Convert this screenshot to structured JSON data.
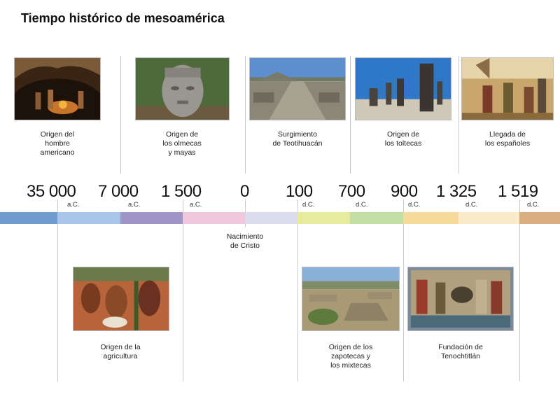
{
  "title": "Tiempo histórico de mesoamérica",
  "years": [
    {
      "value": "35 000",
      "era": "a.C."
    },
    {
      "value": "7 000",
      "era": "a.C."
    },
    {
      "value": "1 500",
      "era": "a.C."
    },
    {
      "value": "0",
      "era": ""
    },
    {
      "value": "100",
      "era": "d.C."
    },
    {
      "value": "700",
      "era": "d.C."
    },
    {
      "value": "900",
      "era": "d.C."
    },
    {
      "value": "1 325",
      "era": "d.C."
    },
    {
      "value": "1 519",
      "era": "d.C."
    }
  ],
  "events_top": [
    {
      "label": "Origen del\nhombre\namericano",
      "image": "cave-people-image"
    },
    {
      "label": "Origen de\nlos olmecas\ny mayas",
      "image": "olmec-head-image"
    },
    {
      "label": "Surgimiento\nde Teotihuacán",
      "image": "teotihuacan-image"
    },
    {
      "label": "Origen de\nlos toltecas",
      "image": "toltec-atlantes-image"
    },
    {
      "label": "Llegada de\nlos españoles",
      "image": "spanish-arrival-image"
    }
  ],
  "events_bottom": [
    {
      "label": "Nacimiento\nde Cristo"
    },
    {
      "label": "Origen de la\nagricultura",
      "image": "agriculture-mural-image"
    },
    {
      "label": "Origen de los\nzapotecas y\nlos mixtecas",
      "image": "monte-alban-image"
    },
    {
      "label": "Fundación de\nTenochtitlán",
      "image": "tenochtitlan-codex-image"
    }
  ],
  "band_colors": [
    "#6f9bd1",
    "#a9c6ea",
    "#9f95c6",
    "#efc8dc",
    "#dcdcec",
    "#e6ec9c",
    "#c2dea2",
    "#f8d99c",
    "#fcebc8",
    "#d9ad81"
  ]
}
